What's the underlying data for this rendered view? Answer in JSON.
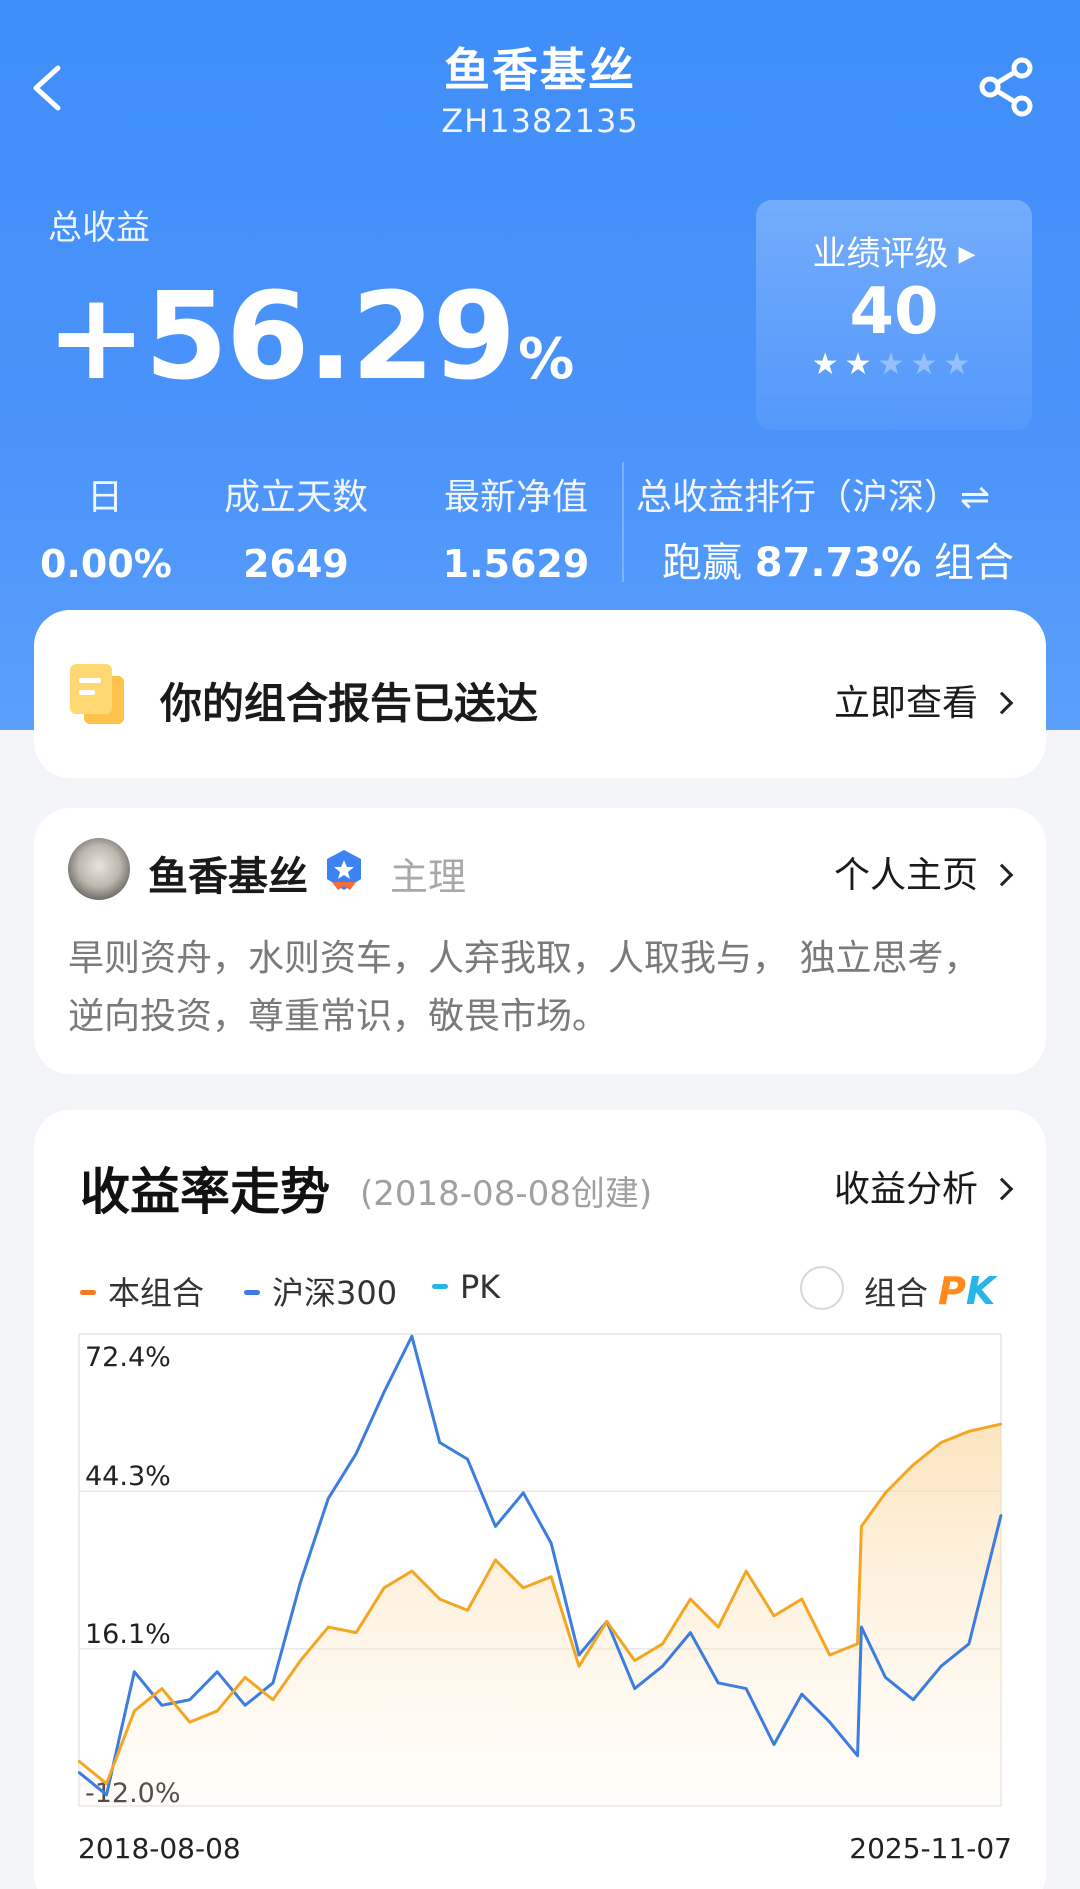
{
  "header": {
    "title": "鱼香基丝",
    "code": "ZH1382135"
  },
  "summary": {
    "total_label": "总收益",
    "total_value": "+56.29",
    "total_unit": "%",
    "rating_label": "业绩评级",
    "rating_value": "40",
    "rating_stars": 2,
    "rating_stars_max": 5
  },
  "stats": {
    "day_label": "日",
    "day_value": "0.00%",
    "days_label": "成立天数",
    "days_value": "2649",
    "nav_label": "最新净值",
    "nav_value": "1.5629",
    "rank_label": "总收益排行（沪深）⇌",
    "rank_prefix": "跑赢",
    "rank_value": "87.73%",
    "rank_suffix": "组合"
  },
  "report": {
    "text": "你的组合报告已送达",
    "link": "立即查看"
  },
  "profile": {
    "name": "鱼香基丝",
    "role": "主理",
    "link": "个人主页",
    "bio": "旱则资舟，水则资车，人弃我取，人取我与， 独立思考，逆向投资，尊重常识，敬畏市场。"
  },
  "chart_section": {
    "title": "收益率走势",
    "created": "(2018-08-08创建)",
    "link": "收益分析",
    "legend_portfolio": "本组合",
    "legend_index": "沪深300",
    "legend_pk": "PK",
    "pk_toggle_label": "组合",
    "pk_badge_p": "P",
    "pk_badge_k": "K"
  },
  "colors": {
    "portfolio": "#f4a623",
    "index": "#3d7de0",
    "pk": "#26b6e8",
    "hero_bg": "#4790fa"
  },
  "chart_data": {
    "type": "line",
    "x_start": "2018-08-08",
    "x_end": "2025-11-07",
    "y_ticks": [
      "72.4%",
      "44.3%",
      "16.1%",
      "-12.0%"
    ],
    "ylim": [
      -12.0,
      72.4
    ],
    "grid": true,
    "series": [
      {
        "name": "本组合",
        "x": [
          "2018-08-08",
          "2018-10-26",
          "2019-01-14",
          "2019-04-03",
          "2019-06-22",
          "2019-09-09",
          "2019-11-28",
          "2020-02-16",
          "2020-05-05",
          "2020-07-24",
          "2020-10-12",
          "2020-12-31",
          "2021-03-21",
          "2021-06-09",
          "2021-08-28",
          "2021-11-16",
          "2022-02-04",
          "2022-04-25",
          "2022-07-14",
          "2022-10-02",
          "2022-12-21",
          "2023-03-11",
          "2023-05-30",
          "2023-08-18",
          "2023-11-06",
          "2024-01-25",
          "2024-04-14",
          "2024-07-03",
          "2024-09-21",
          "2024-10-02",
          "2024-12-10",
          "2025-02-28",
          "2025-05-19",
          "2025-08-07",
          "2025-11-07"
        ],
        "values": [
          -4,
          -8,
          5,
          9,
          3,
          5,
          11,
          7,
          14,
          20,
          19,
          27,
          30,
          25,
          23,
          32,
          27,
          29,
          13,
          21,
          14,
          17,
          25,
          20,
          30,
          22,
          25,
          15,
          17,
          38,
          44,
          49,
          53,
          55,
          56.29
        ]
      },
      {
        "name": "沪深300",
        "x": [
          "2018-08-08",
          "2018-10-26",
          "2019-01-14",
          "2019-04-03",
          "2019-06-22",
          "2019-09-09",
          "2019-11-28",
          "2020-02-16",
          "2020-05-05",
          "2020-07-24",
          "2020-10-12",
          "2020-12-31",
          "2021-03-21",
          "2021-06-09",
          "2021-08-28",
          "2021-11-16",
          "2022-02-04",
          "2022-04-25",
          "2022-07-14",
          "2022-10-02",
          "2022-12-21",
          "2023-03-11",
          "2023-05-30",
          "2023-08-18",
          "2023-11-06",
          "2024-01-25",
          "2024-04-14",
          "2024-07-03",
          "2024-09-21",
          "2024-10-02",
          "2024-12-10",
          "2025-02-28",
          "2025-05-19",
          "2025-08-07",
          "2025-11-07"
        ],
        "values": [
          -6,
          -10,
          12,
          6,
          7,
          12,
          6,
          10,
          28,
          43,
          51,
          62,
          72,
          53,
          50,
          38,
          44,
          35,
          15,
          21,
          9,
          13,
          19,
          10,
          9,
          -1,
          8,
          3,
          -3,
          20,
          11,
          7,
          13,
          17,
          40
        ]
      }
    ]
  }
}
